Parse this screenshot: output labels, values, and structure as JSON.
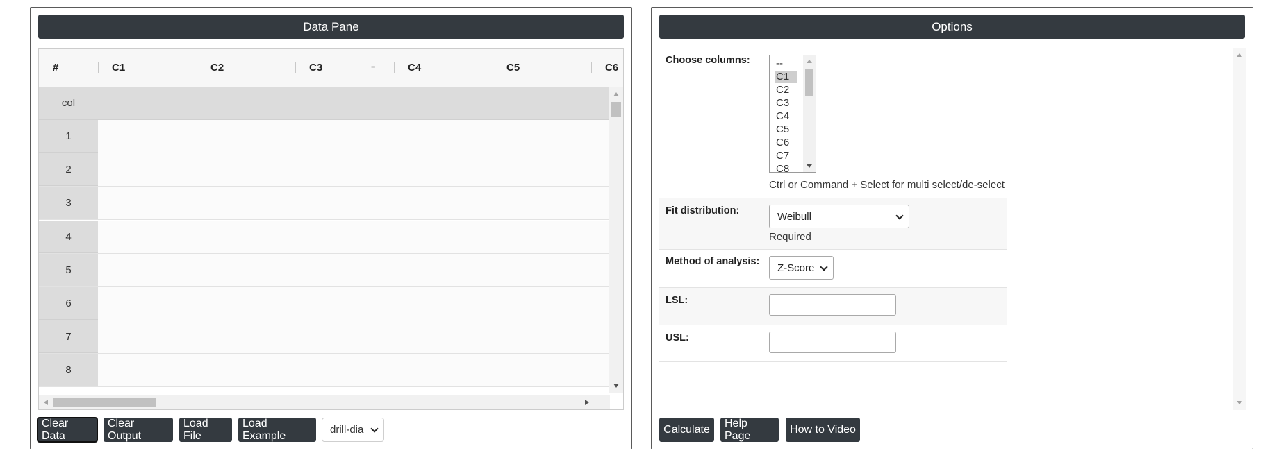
{
  "data_pane": {
    "title": "Data Pane",
    "columns": [
      "#",
      "C1",
      "C2",
      "C3",
      "C4",
      "C5",
      "C6"
    ],
    "header_row_label": "col",
    "rows": [
      "1",
      "2",
      "3",
      "4",
      "5",
      "6",
      "7",
      "8"
    ],
    "buttons": {
      "clear_data": "Clear Data",
      "clear_output": "Clear Output",
      "load_file": "Load File",
      "load_example": "Load Example"
    },
    "example_select": "drill-dia"
  },
  "options": {
    "title": "Options",
    "choose_columns": {
      "label": "Choose columns:",
      "items": [
        "--",
        "C1",
        "C2",
        "C3",
        "C4",
        "C5",
        "C6",
        "C7",
        "C8"
      ],
      "selected": "C1",
      "hint": "Ctrl or Command + Select for multi select/de-select"
    },
    "fit_distribution": {
      "label": "Fit distribution:",
      "value": "Weibull",
      "note": "Required"
    },
    "method": {
      "label": "Method of analysis:",
      "value": "Z-Score"
    },
    "lsl": {
      "label": "LSL:",
      "value": ""
    },
    "usl": {
      "label": "USL:",
      "value": ""
    },
    "buttons": {
      "calculate": "Calculate",
      "help_page": "Help Page",
      "how_to_video": "How to Video"
    }
  }
}
